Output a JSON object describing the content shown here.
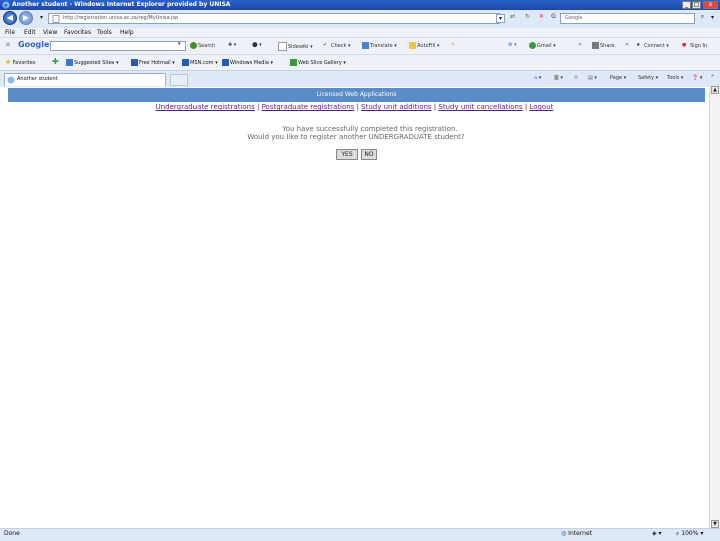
{
  "window": {
    "title": "Another student - Windows Internet Explorer provided by UNISA"
  },
  "address": {
    "url": "http://registration.unisa.ac.za/reg/MyUnisa.jsp",
    "search_text": "Google"
  },
  "menu": [
    "File",
    "Edit",
    "View",
    "Favorites",
    "Tools",
    "Help"
  ],
  "google_toolbar": {
    "logo": "Google",
    "items": [
      "Search",
      "Sidewiki",
      "Check",
      "Translate",
      "AutoFill"
    ],
    "right_items": [
      "Gmail",
      "Share",
      "Sign In"
    ]
  },
  "favorites": {
    "label": "Favorites",
    "items": [
      "Suggested Sites",
      "Free Hotmail",
      "MSN.com",
      "Windows Media",
      "Web Slice Gallery"
    ]
  },
  "tab": {
    "label": "Another student"
  },
  "commands": [
    "Page",
    "Safety",
    "Tools"
  ],
  "app": {
    "header": "Licensed Web Applications",
    "links": [
      "Undergraduate registrations",
      "Postgraduate registrations",
      "Study unit additions",
      "Study unit cancellations",
      "Logout"
    ],
    "message_line1": "You have successfully completed this registration.",
    "message_line2": "Would you like to register another UNDERGRADUATE student?",
    "yes_label": "YES",
    "no_label": "NO"
  },
  "status": {
    "left": "Done",
    "zone": "Internet",
    "zoom": "100%"
  }
}
